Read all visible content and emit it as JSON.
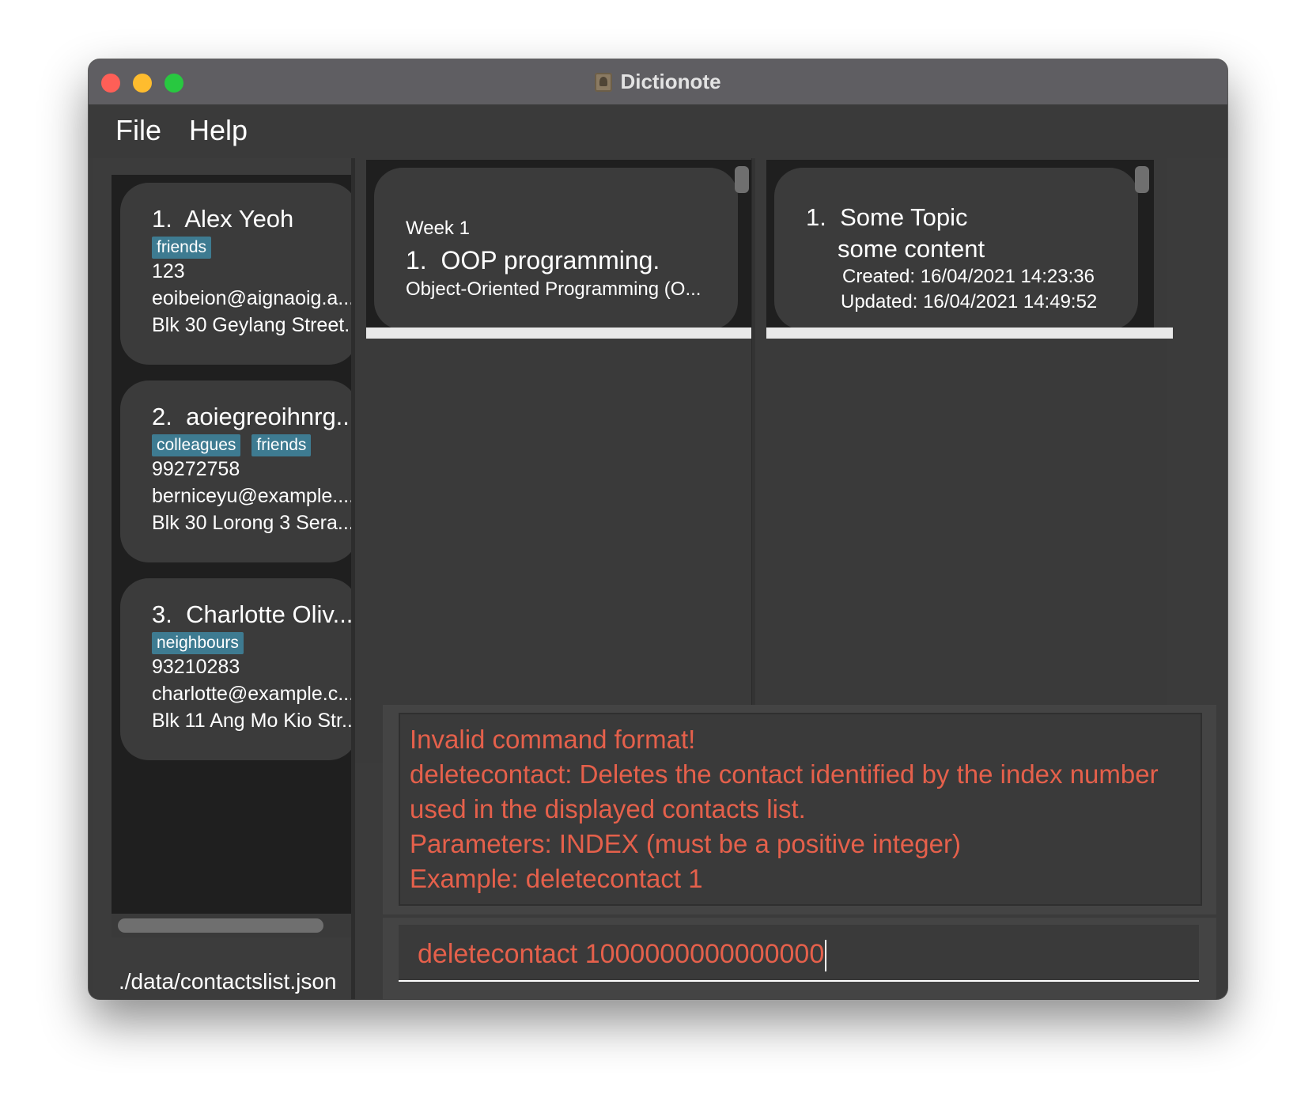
{
  "window": {
    "title": "Dictionote"
  },
  "menu": {
    "file": "File",
    "help": "Help"
  },
  "contacts": [
    {
      "index": "1.",
      "name": "Alex Yeoh",
      "tags": [
        "friends"
      ],
      "phone": "123",
      "email": "eoibeion@aignaoig.a...",
      "address": "Blk 30 Geylang Street..."
    },
    {
      "index": "2.",
      "name": "aoiegreoihnrg...",
      "tags": [
        "colleagues",
        "friends"
      ],
      "phone": "99272758",
      "email": "berniceyu@example....",
      "address": "Blk 30 Lorong 3 Sera..."
    },
    {
      "index": "3.",
      "name": "Charlotte Oliv...",
      "tags": [
        "neighbours"
      ],
      "phone": "93210283",
      "email": "charlotte@example.c...",
      "address": "Blk 11 Ang Mo Kio Str..."
    }
  ],
  "status": {
    "path": "./data/contactslist.json"
  },
  "note": {
    "week": "Week 1",
    "index": "1.",
    "title": "OOP programming.",
    "description": "Object-Oriented Programming (O..."
  },
  "topic": {
    "index": "1.",
    "title": "Some Topic",
    "content": "some content",
    "created": "Created: 16/04/2021 14:23:36",
    "updated": "Updated: 16/04/2021 14:49:52"
  },
  "result": {
    "lines": [
      "Invalid command format!",
      "deletecontact: Deletes the contact identified by the index number",
      "used in the displayed contacts list.",
      "Parameters: INDEX (must be a positive integer)",
      "Example: deletecontact 1"
    ]
  },
  "command": {
    "value": "deletecontact 1000000000000000"
  },
  "colors": {
    "accent_error": "#e5604b",
    "tag": "#3e7b91",
    "background": "#3b3b3b"
  }
}
